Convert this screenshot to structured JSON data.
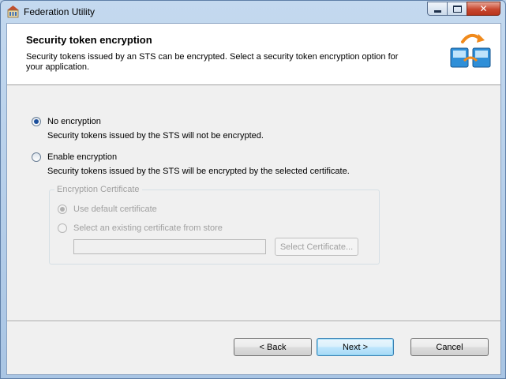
{
  "window": {
    "title": "Federation Utility"
  },
  "header": {
    "title": "Security token encryption",
    "description": "Security tokens issued by an STS can be encrypted. Select a security token encryption option for your application."
  },
  "options": {
    "no_encryption": {
      "label": "No encryption",
      "description": "Security tokens issued by the STS will not be encrypted.",
      "selected": true
    },
    "enable_encryption": {
      "label": "Enable encryption",
      "description": "Security tokens issued by the STS will be encrypted by the selected certificate.",
      "selected": false
    }
  },
  "encryption_certificate": {
    "legend": "Encryption Certificate",
    "use_default_label": "Use default certificate",
    "select_existing_label": "Select an existing certificate from store",
    "certificate_value": "",
    "select_button_label": "Select Certificate...",
    "enabled": false
  },
  "footer": {
    "back_label": "< Back",
    "next_label": "Next >",
    "cancel_label": "Cancel"
  },
  "colors": {
    "accent": "#1c4f9c",
    "disabled_text": "#a0a0a0"
  }
}
